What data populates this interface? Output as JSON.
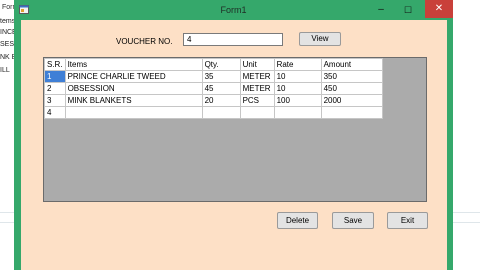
{
  "window": {
    "title": "Form1",
    "controls": {
      "minimize": "–",
      "maximize": "☐",
      "close": "✕"
    }
  },
  "background_window": {
    "title": "Form",
    "items": [
      "tems",
      "INCE",
      "SESS",
      "NK B",
      "ILL"
    ]
  },
  "voucher": {
    "label": "VOUCHER NO.",
    "value": "4"
  },
  "buttons": {
    "view": "View",
    "delete": "Delete",
    "save": "Save",
    "exit": "Exit"
  },
  "grid": {
    "columns": [
      "S.R.",
      "Items",
      "Qty.",
      "Unit",
      "Rate",
      "Amount"
    ],
    "rows": [
      [
        "1",
        "PRINCE CHARLIE TWEED",
        "35",
        "METER",
        "10",
        "350"
      ],
      [
        "2",
        "OBSESSION",
        "45",
        "METER",
        "10",
        "450"
      ],
      [
        "3",
        "MINK BLANKETS",
        "20",
        "PCS",
        "100",
        "2000"
      ],
      [
        "4",
        "",
        "",
        "",
        "",
        ""
      ]
    ]
  },
  "colors": {
    "window_frame": "#35a86b",
    "client_background": "#fde0c6",
    "grid_background": "#ababab",
    "selected_cell": "#3f7fd6",
    "close_button": "#c9403a"
  }
}
